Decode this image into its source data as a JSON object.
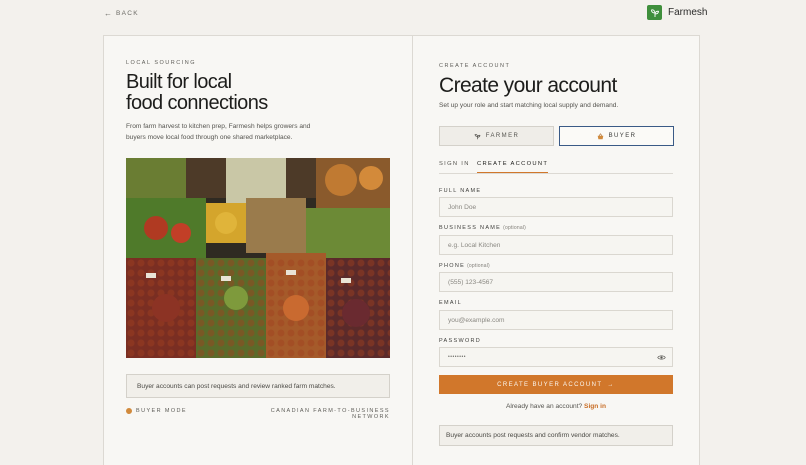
{
  "nav": {
    "back_label": "BACK",
    "back_icon": "arrow-left-icon"
  },
  "brand": {
    "name": "Farmesh",
    "icon": "sprout-icon",
    "color": "#3f8f3c"
  },
  "left": {
    "eyebrow": "LOCAL SOURCING",
    "headline_line1": "Built for local",
    "headline_line2": "food connections",
    "intro": "From farm harvest to kitchen prep, Farmesh helps growers and buyers move local food through one shared marketplace.",
    "image_subject": "market produce stall",
    "note": "Buyer accounts can post requests and review ranked farm matches.",
    "mode_label": "BUYER MODE",
    "network_label": "CANADIAN FARM-TO-BUSINESS NETWORK"
  },
  "right": {
    "eyebrow": "CREATE ACCOUNT",
    "title": "Create your account",
    "subtitle": "Set up your role and start matching local supply and demand.",
    "roles": [
      {
        "label": "FARMER",
        "icon": "sprout-icon",
        "selected": false
      },
      {
        "label": "BUYER",
        "icon": "basket-icon",
        "selected": true
      }
    ],
    "tabs": [
      {
        "label": "SIGN IN",
        "active": false
      },
      {
        "label": "CREATE ACCOUNT",
        "active": true
      }
    ],
    "fields": {
      "full_name": {
        "label": "FULL NAME",
        "optional": "",
        "placeholder": "John Doe"
      },
      "business_name": {
        "label": "BUSINESS NAME",
        "optional": "(optional)",
        "placeholder": "e.g. Local Kitchen"
      },
      "phone": {
        "label": "PHONE",
        "optional": "(optional)",
        "placeholder": "(555) 123-4567"
      },
      "email": {
        "label": "EMAIL",
        "optional": "",
        "placeholder": "you@example.com"
      },
      "password": {
        "label": "PASSWORD",
        "optional": "",
        "value": "••••••••"
      }
    },
    "submit_label": "CREATE BUYER ACCOUNT",
    "have_account_text": "Already have an account?",
    "signin_link": "Sign in",
    "info": "Buyer accounts post requests and confirm vendor matches."
  },
  "colors": {
    "accent": "#d1772b",
    "selected_border": "#3a5a86",
    "background": "#f3f1ed"
  }
}
